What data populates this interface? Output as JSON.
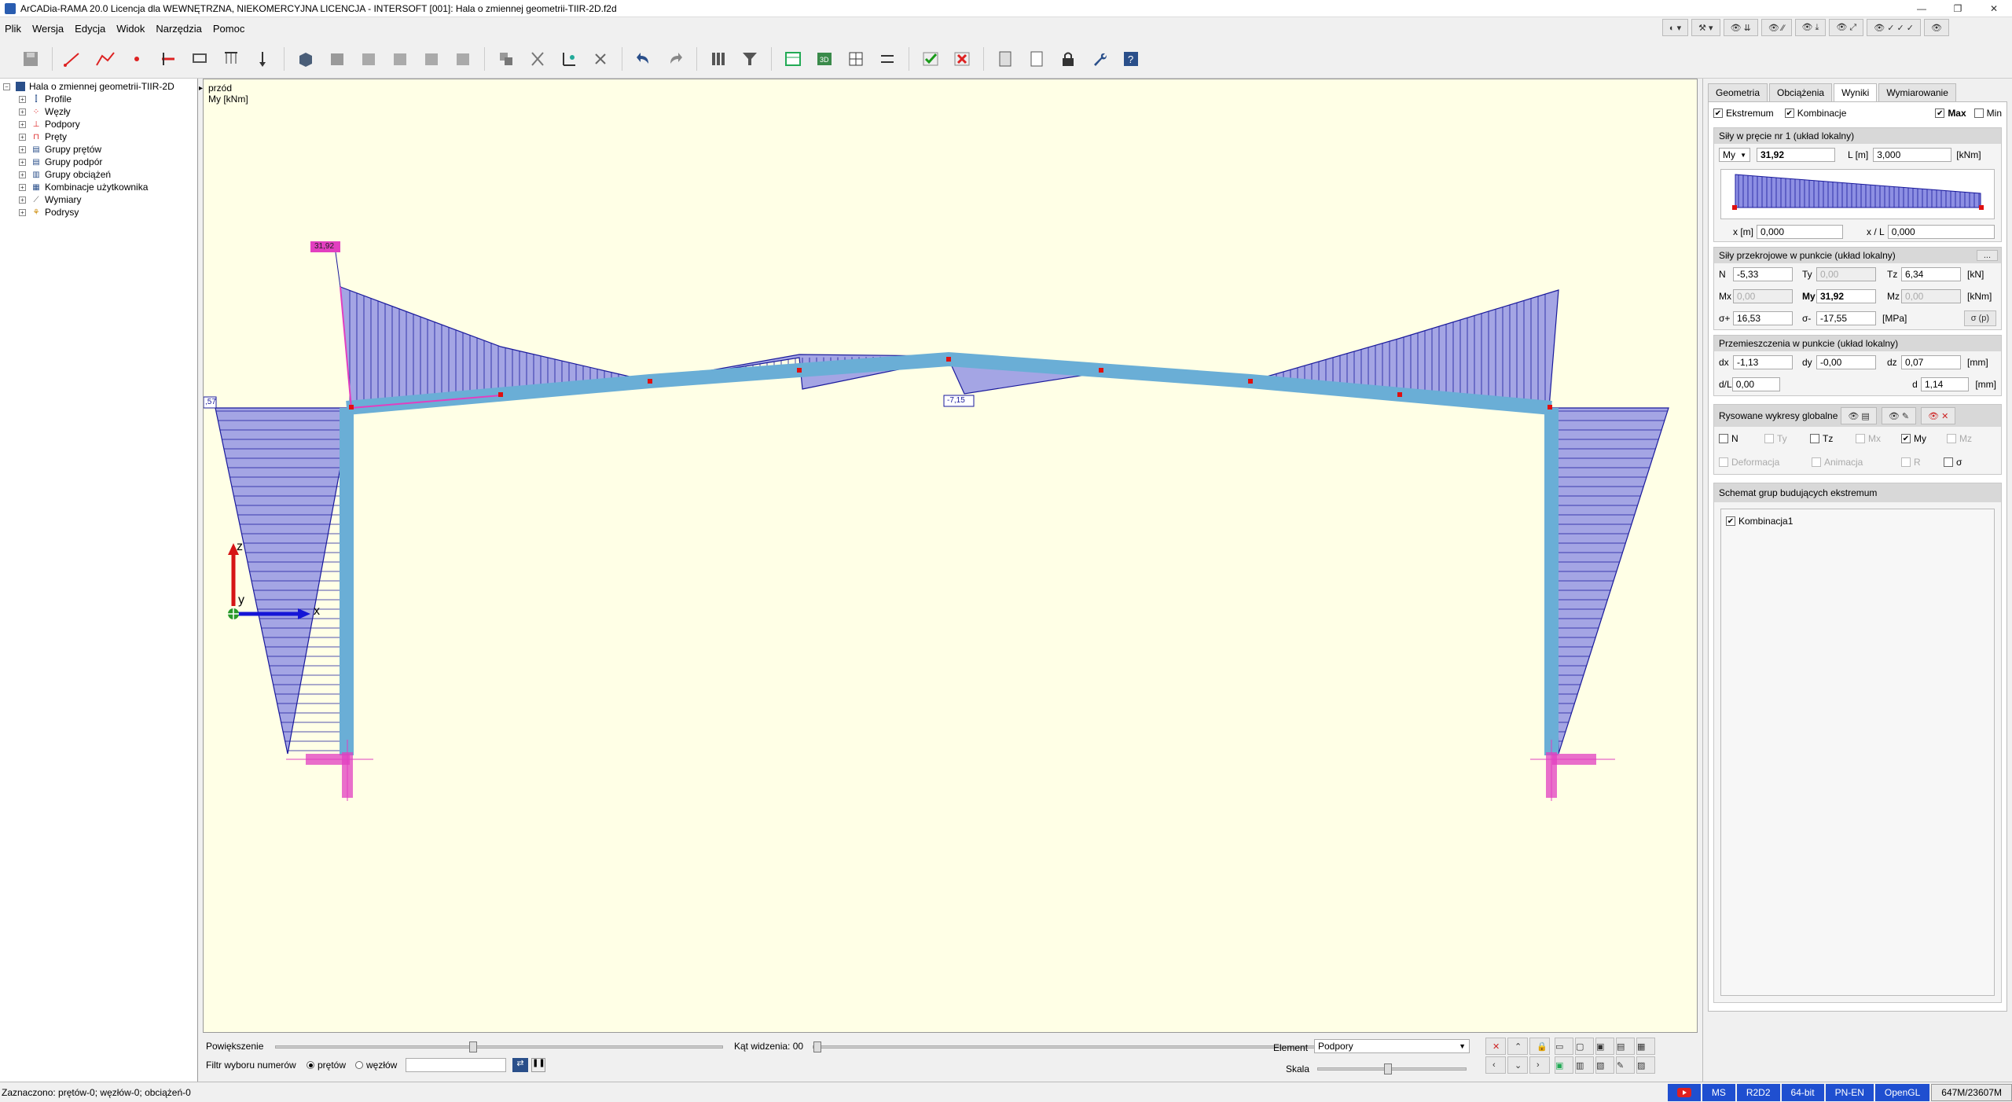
{
  "window": {
    "title": "ArCADia-RAMA 20.0 Licencja dla WEWNĘTRZNA, NIEKOMERCYJNA LICENCJA - INTERSOFT [001]: Hala o zmiennej geometrii-TIIR-2D.f2d",
    "minimize": "—",
    "restore": "❐",
    "close": "✕"
  },
  "menu": [
    "Plik",
    "Wersja",
    "Edycja",
    "Widok",
    "Narzędzia",
    "Pomoc"
  ],
  "tree": {
    "root": "Hala o zmiennej geometrii-TIIR-2D",
    "items": [
      "Profile",
      "Węzły",
      "Podpory",
      "Pręty",
      "Grupy prętów",
      "Grupy podpór",
      "Grupy obciążeń",
      "Kombinacje użytkownika",
      "Wymiary",
      "Podrysy"
    ]
  },
  "canvas": {
    "view_name": "przód",
    "quantity": "My [kNm]",
    "labels": {
      "max_value": "31,92",
      "left_value": ",57",
      "mid_value": "-7,15"
    },
    "axis": {
      "x": "x",
      "y": "y",
      "z": "z"
    },
    "colors": {
      "background": "#ffffe6",
      "frame": "#6aaed6",
      "diagram_fill": "#8d8fe3",
      "diagram_line": "#1a1a9c",
      "support": "#e23fc0",
      "node": "#e01010"
    }
  },
  "bottom": {
    "zoom_label": "Powiększenie",
    "angle_label": "Kąt widzenia: 00",
    "filter_label": "Filtr wyboru numerów",
    "radio_bars": "prętów",
    "radio_nodes": "węzłów",
    "element_label": "Element",
    "element_value": "Podpory",
    "scale_label": "Skala"
  },
  "panel": {
    "tabs": [
      "Geometria",
      "Obciążenia",
      "Wyniki",
      "Wymiarowanie"
    ],
    "active_tab": "Wyniki",
    "opts": {
      "extremum": "Ekstremum",
      "combination": "Kombinacje",
      "max": "Max",
      "min": "Min"
    },
    "bar_forces": {
      "title": "Siły w pręcie nr 1 (układ lokalny)",
      "quantity": "My",
      "value": "31,92",
      "length_label": "L [m]",
      "length": "3,000",
      "unit": "[kNm]",
      "x_label": "x [m]",
      "x_value": "0,000",
      "xl_label": "x / L",
      "xl_value": "0,000"
    },
    "section_forces": {
      "title": "Siły przekrojowe w punkcie (układ lokalny)",
      "btn": "...",
      "N_label": "N",
      "N": "-5,33",
      "Ty_label": "Ty",
      "Ty": "0,00",
      "Tz_label": "Tz",
      "Tz": "6,34",
      "unit_kN": "[kN]",
      "Mx_label": "Mx",
      "Mx": "0,00",
      "My_label": "My",
      "My": "31,92",
      "Mz_label": "Mz",
      "Mz": "0,00",
      "unit_kNm": "[kNm]",
      "sp_label": "σ+",
      "sp": "16,53",
      "sm_label": "σ-",
      "sm": "-17,55",
      "unit_MPa": "[MPa]",
      "sigma_btn": "σ (p)"
    },
    "displacements": {
      "title": "Przemieszczenia w punkcie (układ lokalny)",
      "dx_label": "dx",
      "dx": "-1,13",
      "dy_label": "dy",
      "dy": "-0,00",
      "dz_label": "dz",
      "dz": "0,07",
      "unit_mm": "[mm]",
      "dl_label": "d/L",
      "dl": "0,00",
      "d_label": "d",
      "d": "1,14"
    },
    "global": {
      "title": "Rysowane wykresy globalne",
      "N": "N",
      "Ty": "Ty",
      "Tz": "Tz",
      "Mx": "Mx",
      "My": "My",
      "Mz": "Mz",
      "deform": "Deformacja",
      "anim": "Animacja",
      "R": "R",
      "sigma": "σ"
    },
    "groups": {
      "title": "Schemat grup budujących ekstremum",
      "item": "Kombinacja1"
    }
  },
  "status": {
    "text": "Zaznaczono: prętów-0; węzłów-0; obciążeń-0",
    "badges": [
      "MS",
      "R2D2",
      "64-bit",
      "PN-EN",
      "OpenGL"
    ],
    "memory": "647M/23607M"
  }
}
